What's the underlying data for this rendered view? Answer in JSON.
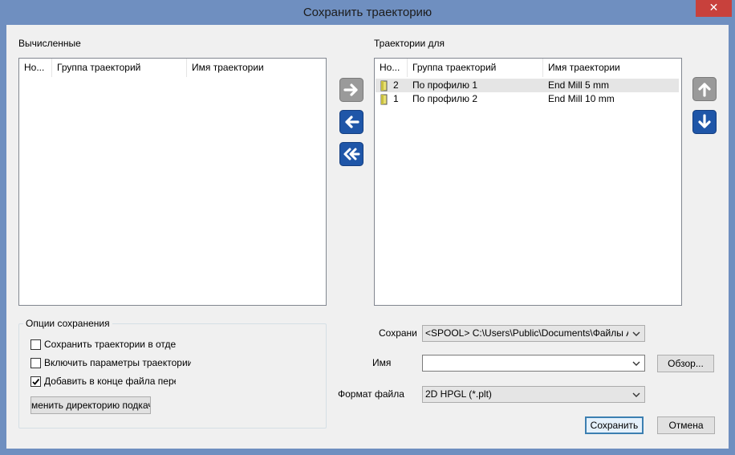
{
  "window": {
    "title": "Сохранить траекторию",
    "close_glyph": "✕"
  },
  "computed": {
    "label": "Вычисленные",
    "columns": [
      "Но...",
      "Группа траекторий",
      "Имя траектории"
    ]
  },
  "toolpaths_for": {
    "label": "Траектории для",
    "columns": [
      "Но...",
      "Группа траекторий",
      "Имя траектории"
    ],
    "rows": [
      {
        "number": "2",
        "group": "По профилю 1",
        "name": "End Mill 5 mm",
        "selected": true
      },
      {
        "number": "1",
        "group": "По профилю 2",
        "name": "End Mill 10 mm",
        "selected": false
      }
    ]
  },
  "transfer_buttons": [
    "arrow-right-icon",
    "arrow-left-icon",
    "double-arrow-left-icon"
  ],
  "order_buttons": [
    "arrow-up-icon",
    "arrow-down-icon"
  ],
  "options": {
    "title": "Опции сохранения",
    "items": [
      {
        "label": "Сохранить траектории в отдельн",
        "checked": false
      },
      {
        "label": "Включить параметры траектории в ф",
        "checked": false
      },
      {
        "label": "Добавить в конце файла переме",
        "checked": true
      }
    ],
    "change_dir_button": "менить директорию подкачк"
  },
  "form": {
    "save_label": "Сохрани",
    "save_value": "<SPOOL> C:\\Users\\Public\\Documents\\Файлы ArtCA",
    "name_label": "Имя",
    "name_value": "",
    "browse_button": "Обзор...",
    "format_label": "Формат файла",
    "format_value": "2D HPGL (*.plt)"
  },
  "actions": {
    "save": "Сохранить",
    "cancel": "Отмена"
  },
  "colors": {
    "title_bar": "#6f8fc0",
    "close_button": "#c8413c",
    "arrow_blue": "#1f56a8",
    "arrow_gray": "#8c8c8c",
    "selection": "#e5e5e5"
  }
}
